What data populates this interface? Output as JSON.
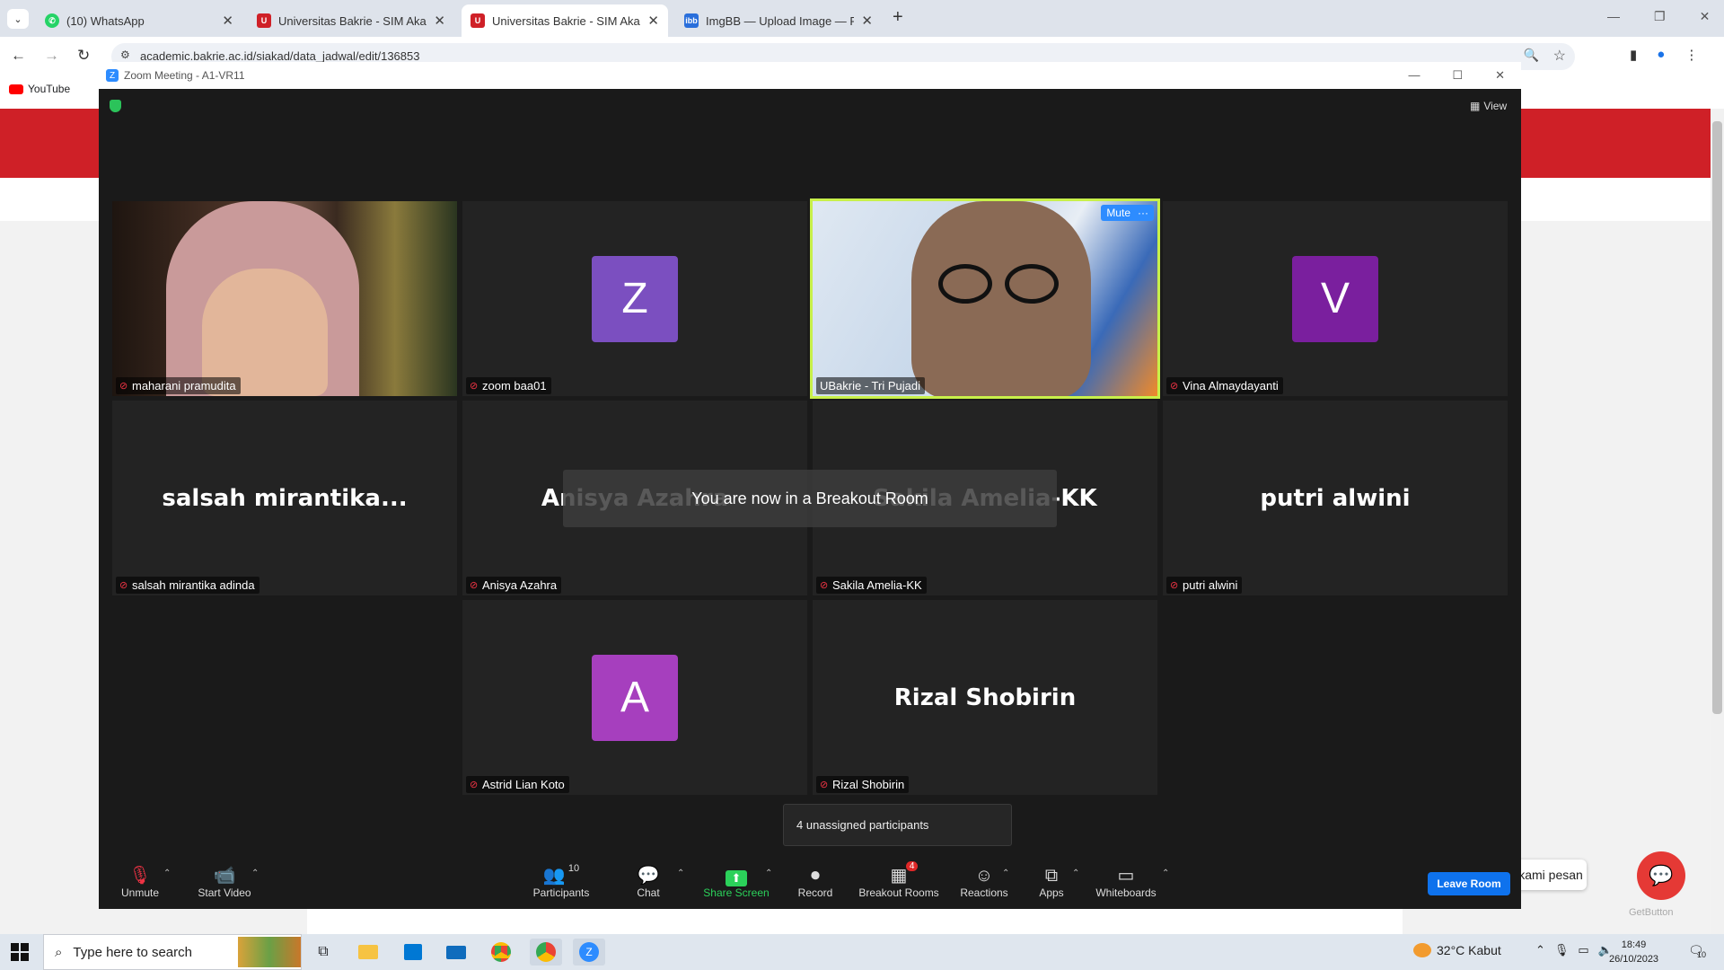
{
  "browser": {
    "tabs": [
      {
        "title": "(10) WhatsApp",
        "favicon": "whatsapp-icon",
        "color": "#25d366"
      },
      {
        "title": "Universitas Bakrie - SIM Akade",
        "favicon": "shield-logo-icon",
        "color": "#cf2027"
      },
      {
        "title": "Universitas Bakrie - SIM Akade",
        "favicon": "shield-logo-icon",
        "color": "#cf2027"
      },
      {
        "title": "ImgBB — Upload Image — Fre",
        "favicon": "imgbb-icon",
        "color": "#2a6fdb"
      }
    ],
    "url": "academic.bakrie.ac.id/siakad/data_jadwal/edit/136853",
    "bookmarks": [
      {
        "label": "YouTube"
      }
    ]
  },
  "zoom": {
    "window_title": "Zoom Meeting - A1-VR11",
    "view_label": "View",
    "breakout_banner": "You are now in a Breakout Room",
    "unassigned_tooltip": "4 unassigned participants",
    "tiles": [
      {
        "name": "maharani pramudita",
        "type": "video",
        "muted": true
      },
      {
        "name": "zoom baa01",
        "type": "avatar",
        "initial": "Z",
        "color": "#7b4fc0",
        "muted": true
      },
      {
        "name": "UBakrie - Tri Pujadi",
        "type": "video",
        "active_speaker": true,
        "badge": "Mute",
        "muted": false
      },
      {
        "name": "Vina Almaydayanti",
        "type": "avatar",
        "initial": "V",
        "color": "#7a1f9e",
        "muted": true
      },
      {
        "name": "salsah mirantika adinda",
        "type": "text",
        "display": "salsah  mirantika...",
        "muted": true
      },
      {
        "name": "Anisya Azahra",
        "type": "text",
        "display": "Anisya Azahra",
        "muted": true
      },
      {
        "name": "Sakila Amelia-KK",
        "type": "text",
        "display": "Sakila Amelia-KK",
        "muted": true
      },
      {
        "name": "putri alwini",
        "type": "text",
        "display": "putri alwini",
        "muted": true
      },
      {
        "name": "Astrid Lian Koto",
        "type": "avatar",
        "initial": "A",
        "color": "#a63fbe",
        "muted": true
      },
      {
        "name": "Rizal Shobirin",
        "type": "text",
        "display": "Rizal Shobirin",
        "muted": true
      }
    ],
    "controls": {
      "unmute": "Unmute",
      "start_video": "Start Video",
      "participants": "Participants",
      "participants_count": "10",
      "chat": "Chat",
      "share_screen": "Share Screen",
      "record": "Record",
      "breakout_rooms": "Breakout Rooms",
      "breakout_badge": "4",
      "reactions": "Reactions",
      "apps": "Apps",
      "whiteboards": "Whiteboards",
      "leave_room": "Leave Room"
    }
  },
  "page": {
    "chat_widget_text": "kami pesan",
    "getbutton_label": "GetButton"
  },
  "taskbar": {
    "search_placeholder": "Type here to search",
    "weather": "32°C  Kabut",
    "time": "18:49",
    "date": "26/10/2023",
    "notification_count": "10"
  }
}
